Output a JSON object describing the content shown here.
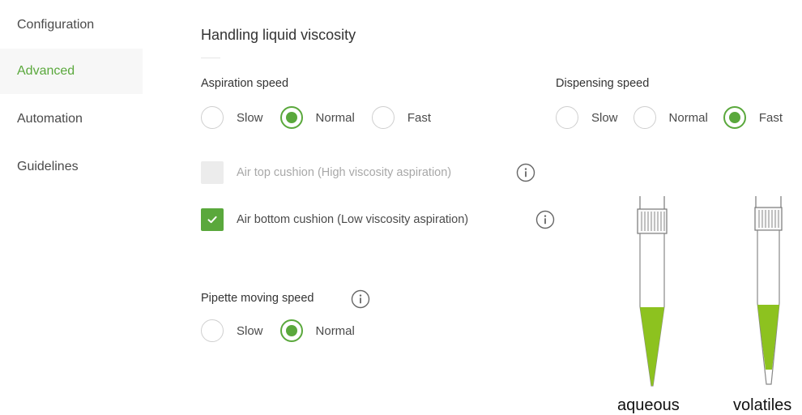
{
  "sidebar": {
    "items": [
      {
        "label": "Configuration",
        "active": false
      },
      {
        "label": "Advanced",
        "active": true
      },
      {
        "label": "Automation",
        "active": false
      },
      {
        "label": "Guidelines",
        "active": false
      }
    ]
  },
  "main": {
    "title": "Handling liquid viscosity",
    "aspiration": {
      "label": "Aspiration speed",
      "options": [
        "Slow",
        "Normal",
        "Fast"
      ],
      "selected": "Normal"
    },
    "dispensing": {
      "label": "Dispensing speed",
      "options": [
        "Slow",
        "Normal",
        "Fast"
      ],
      "selected": "Fast"
    },
    "air_top_cushion": {
      "label": "Air top cushion (High viscosity aspiration)",
      "checked": false,
      "disabled": true
    },
    "air_bottom_cushion": {
      "label": "Air bottom cushion (Low viscosity aspiration)",
      "checked": true,
      "disabled": false
    },
    "pipette_speed": {
      "label": "Pipette moving speed",
      "options": [
        "Slow",
        "Normal"
      ],
      "selected": "Normal"
    }
  },
  "illustration": {
    "tips": [
      {
        "label": "aqueous",
        "liquid_color": "#8dc21f"
      },
      {
        "label": "volatiles",
        "liquid_color": "#8dc21f"
      }
    ]
  },
  "colors": {
    "accent": "#5aa83c"
  }
}
